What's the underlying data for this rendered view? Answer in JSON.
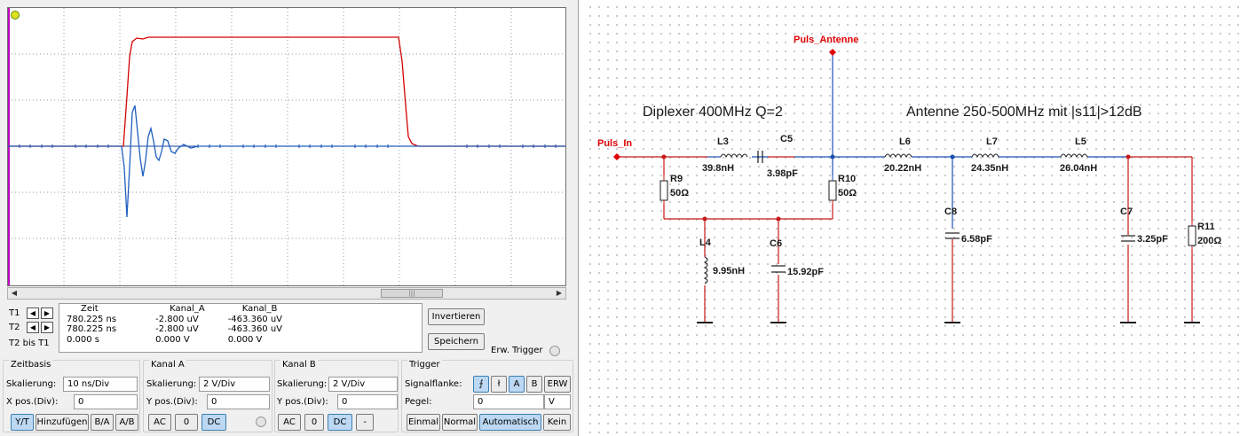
{
  "scope": {
    "cursor": {
      "t1_label": "T1",
      "t2_label": "T2",
      "diff_label": "T2 bis T1",
      "headers": [
        "Zeit",
        "Kanal_A",
        "Kanal_B"
      ],
      "rows": [
        [
          "780.225 ns",
          "-2.800 uV",
          "-463.360 uV"
        ],
        [
          "780.225 ns",
          "-2.800 uV",
          "-463.360 uV"
        ],
        [
          "0.000 s",
          "0.000 V",
          "0.000 V"
        ]
      ]
    },
    "invert_label": "Invertieren",
    "save_label": "Speichern",
    "ext_trigger_label": "Erw. Trigger",
    "timebase": {
      "title": "Zeitbasis",
      "scale_label": "Skalierung:",
      "scale_value": "10 ns/Div",
      "xpos_label": "X pos.(Div):",
      "xpos_value": "0",
      "buttons": [
        "Y/T",
        "Hinzufügen",
        "B/A",
        "A/B"
      ]
    },
    "channel_a": {
      "title": "Kanal A",
      "scale_label": "Skalierung:",
      "scale_value": "2  V/Div",
      "ypos_label": "Y pos.(Div):",
      "ypos_value": "0",
      "buttons": [
        "AC",
        "0",
        "DC"
      ]
    },
    "channel_b": {
      "title": "Kanal B",
      "scale_label": "Skalierung:",
      "scale_value": "2  V/Div",
      "ypos_label": "Y pos.(Div):",
      "ypos_value": "0",
      "buttons": [
        "AC",
        "0",
        "DC",
        "-"
      ]
    },
    "trigger": {
      "title": "Trigger",
      "edge_label": "Signalflanke:",
      "edge_buttons": [
        "A",
        "B",
        "ERW"
      ],
      "level_label": "Pegel:",
      "level_value": "0",
      "level_unit": "V",
      "mode_buttons": [
        "Einmal",
        "Normal",
        "Automatisch",
        "Kein"
      ]
    },
    "colors": {
      "channel_a": "#d40000",
      "channel_b": "#1f5fbf",
      "grid": "#9a9a9a"
    }
  },
  "schematic": {
    "ports": [
      "Puls_In",
      "Puls_Antenne"
    ],
    "notes": [
      "Diplexer 400MHz Q=2",
      "Antenne 250-500MHz mit |s11|>12dB"
    ],
    "components": [
      {
        "ref": "L3",
        "value": "39.8nH"
      },
      {
        "ref": "C5",
        "value": "3.98pF"
      },
      {
        "ref": "R9",
        "value": "50Ω"
      },
      {
        "ref": "R10",
        "value": "50Ω"
      },
      {
        "ref": "L4",
        "value": "9.95nH"
      },
      {
        "ref": "C6",
        "value": "15.92pF"
      },
      {
        "ref": "L6",
        "value": "20.22nH"
      },
      {
        "ref": "L7",
        "value": "24.35nH"
      },
      {
        "ref": "L5",
        "value": "26.04nH"
      },
      {
        "ref": "C8",
        "value": "6.58pF"
      },
      {
        "ref": "C7",
        "value": "3.25pF"
      },
      {
        "ref": "R11",
        "value": "200Ω"
      }
    ],
    "colors": {
      "port": "#e00000",
      "wire_red": "#c81818",
      "wire_blue": "#1a4fb0"
    }
  }
}
